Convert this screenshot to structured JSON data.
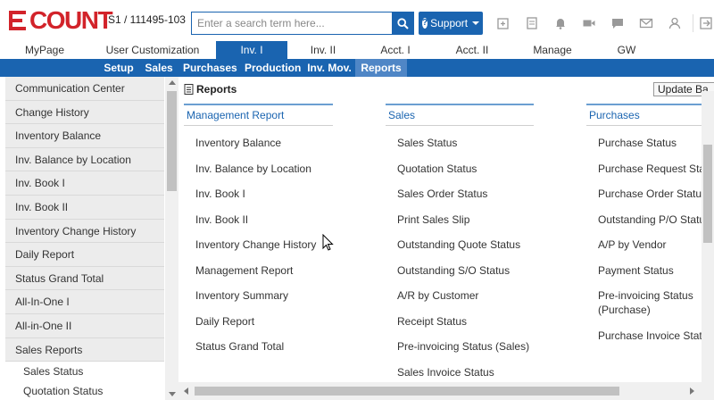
{
  "brand": {
    "logo_text": "COUNT",
    "logo_full": "ECOUNT",
    "accent": "#d2232a",
    "nav_blue": "#1a64b0"
  },
  "header": {
    "company_info": "S1 / 111495-103",
    "search_placeholder": "Enter a search term here...",
    "support_label": "Support",
    "icons": [
      "search-icon",
      "question-icon",
      "new-window-icon",
      "document-icon",
      "bell-icon",
      "video-icon",
      "chat-icon",
      "mail-icon",
      "user-icon",
      "logout-icon"
    ]
  },
  "main_nav": {
    "tabs": [
      {
        "label": "MyPage"
      },
      {
        "label": "User Customization"
      },
      {
        "label": "Inv. I",
        "active": true
      },
      {
        "label": "Inv. II"
      },
      {
        "label": "Acct. I"
      },
      {
        "label": "Acct. II"
      },
      {
        "label": "Manage"
      },
      {
        "label": "GW"
      }
    ]
  },
  "sub_nav": {
    "tabs": [
      {
        "label": "Setup"
      },
      {
        "label": "Sales"
      },
      {
        "label": "Purchases"
      },
      {
        "label": "Production"
      },
      {
        "label": "Inv. Mov."
      },
      {
        "label": "Reports",
        "active": true
      }
    ]
  },
  "sidebar": {
    "items": [
      {
        "label": "Communication Center"
      },
      {
        "label": "Change History"
      },
      {
        "label": "Inventory Balance"
      },
      {
        "label": "Inv. Balance by Location"
      },
      {
        "label": "Inv. Book I"
      },
      {
        "label": "Inv. Book II"
      },
      {
        "label": "Inventory Change History"
      },
      {
        "label": "Daily Report"
      },
      {
        "label": "Status Grand Total"
      },
      {
        "label": "All-In-One I"
      },
      {
        "label": "All-in-One II"
      },
      {
        "label": "Sales Reports"
      }
    ],
    "sub_items": [
      {
        "label": "Sales Status"
      },
      {
        "label": "Quotation Status"
      }
    ]
  },
  "content": {
    "title": "Reports",
    "update_button": "Update Ba",
    "columns": [
      {
        "heading": "Management Report",
        "items": [
          "Inventory Balance",
          "Inv. Balance by Location",
          "Inv. Book I",
          "Inv. Book II",
          "Inventory Change History",
          "Management Report",
          "Inventory Summary",
          "Daily Report",
          "Status Grand Total"
        ]
      },
      {
        "heading": "Sales",
        "items": [
          "Sales Status",
          "Quotation Status",
          "Sales Order Status",
          "Print Sales Slip",
          "Outstanding Quote Status",
          "Outstanding S/O Status",
          "A/R by Customer",
          "Receipt Status",
          "Pre-invoicing Status (Sales)",
          "Sales Invoice Status"
        ]
      },
      {
        "heading": "Purchases",
        "items": [
          "Purchase Status",
          "Purchase Request Status",
          "Purchase Order Status",
          "Outstanding P/O Status",
          "A/P by Vendor",
          "Payment Status",
          "Pre-invoicing Status (Purchase)",
          "Purchase Invoice Status"
        ]
      }
    ]
  }
}
